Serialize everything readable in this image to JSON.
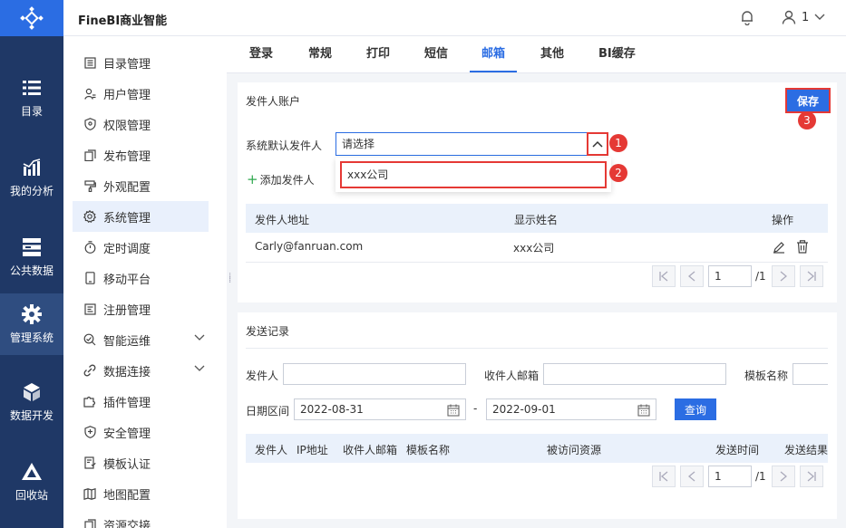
{
  "app": {
    "title": "FineBI商业智能",
    "user_count": "1"
  },
  "rail": [
    {
      "label": "目录",
      "icon": "list-icon"
    },
    {
      "label": "我的分析",
      "icon": "analysis-chart-icon"
    },
    {
      "label": "公共数据",
      "icon": "database-icon"
    },
    {
      "label": "管理系统",
      "icon": "gear-icon"
    },
    {
      "label": "数据开发",
      "icon": "cube-icon"
    },
    {
      "label": "回收站",
      "icon": "recycle-icon"
    }
  ],
  "menu": [
    {
      "label": "目录管理"
    },
    {
      "label": "用户管理"
    },
    {
      "label": "权限管理"
    },
    {
      "label": "发布管理"
    },
    {
      "label": "外观配置"
    },
    {
      "label": "系统管理"
    },
    {
      "label": "定时调度"
    },
    {
      "label": "移动平台"
    },
    {
      "label": "注册管理"
    },
    {
      "label": "智能运维"
    },
    {
      "label": "数据连接"
    },
    {
      "label": "插件管理"
    },
    {
      "label": "安全管理"
    },
    {
      "label": "模板认证"
    },
    {
      "label": "地图配置"
    },
    {
      "label": "资源交接"
    }
  ],
  "tabs": [
    "登录",
    "常规",
    "打印",
    "短信",
    "邮箱",
    "其他",
    "BI缓存"
  ],
  "sender": {
    "title": "发件人账户",
    "save_label": "保存",
    "default_label": "系统默认发件人",
    "select_placeholder": "请选择",
    "dropdown_option": "xxx公司",
    "add_label": "添加发件人",
    "columns": [
      "发件人地址",
      "显示姓名",
      "操作"
    ],
    "rows": [
      {
        "address": "Carly@fanruan.com",
        "name": "xxx公司"
      }
    ],
    "page": "1",
    "total": "/1"
  },
  "badges": [
    "1",
    "2",
    "3"
  ],
  "log": {
    "title": "发送记录",
    "sender_label": "发件人",
    "recipient_label": "收件人邮箱",
    "template_label": "模板名称",
    "date_label": "日期区间",
    "date_from": "2022-08-31",
    "date_sep": "-",
    "date_to": "2022-09-01",
    "query_label": "查询",
    "columns": [
      "发件人",
      "IP地址",
      "收件人邮箱",
      "模板名称",
      "被访问资源",
      "发送时间",
      "发送结果"
    ],
    "page": "1",
    "total": "/1"
  }
}
